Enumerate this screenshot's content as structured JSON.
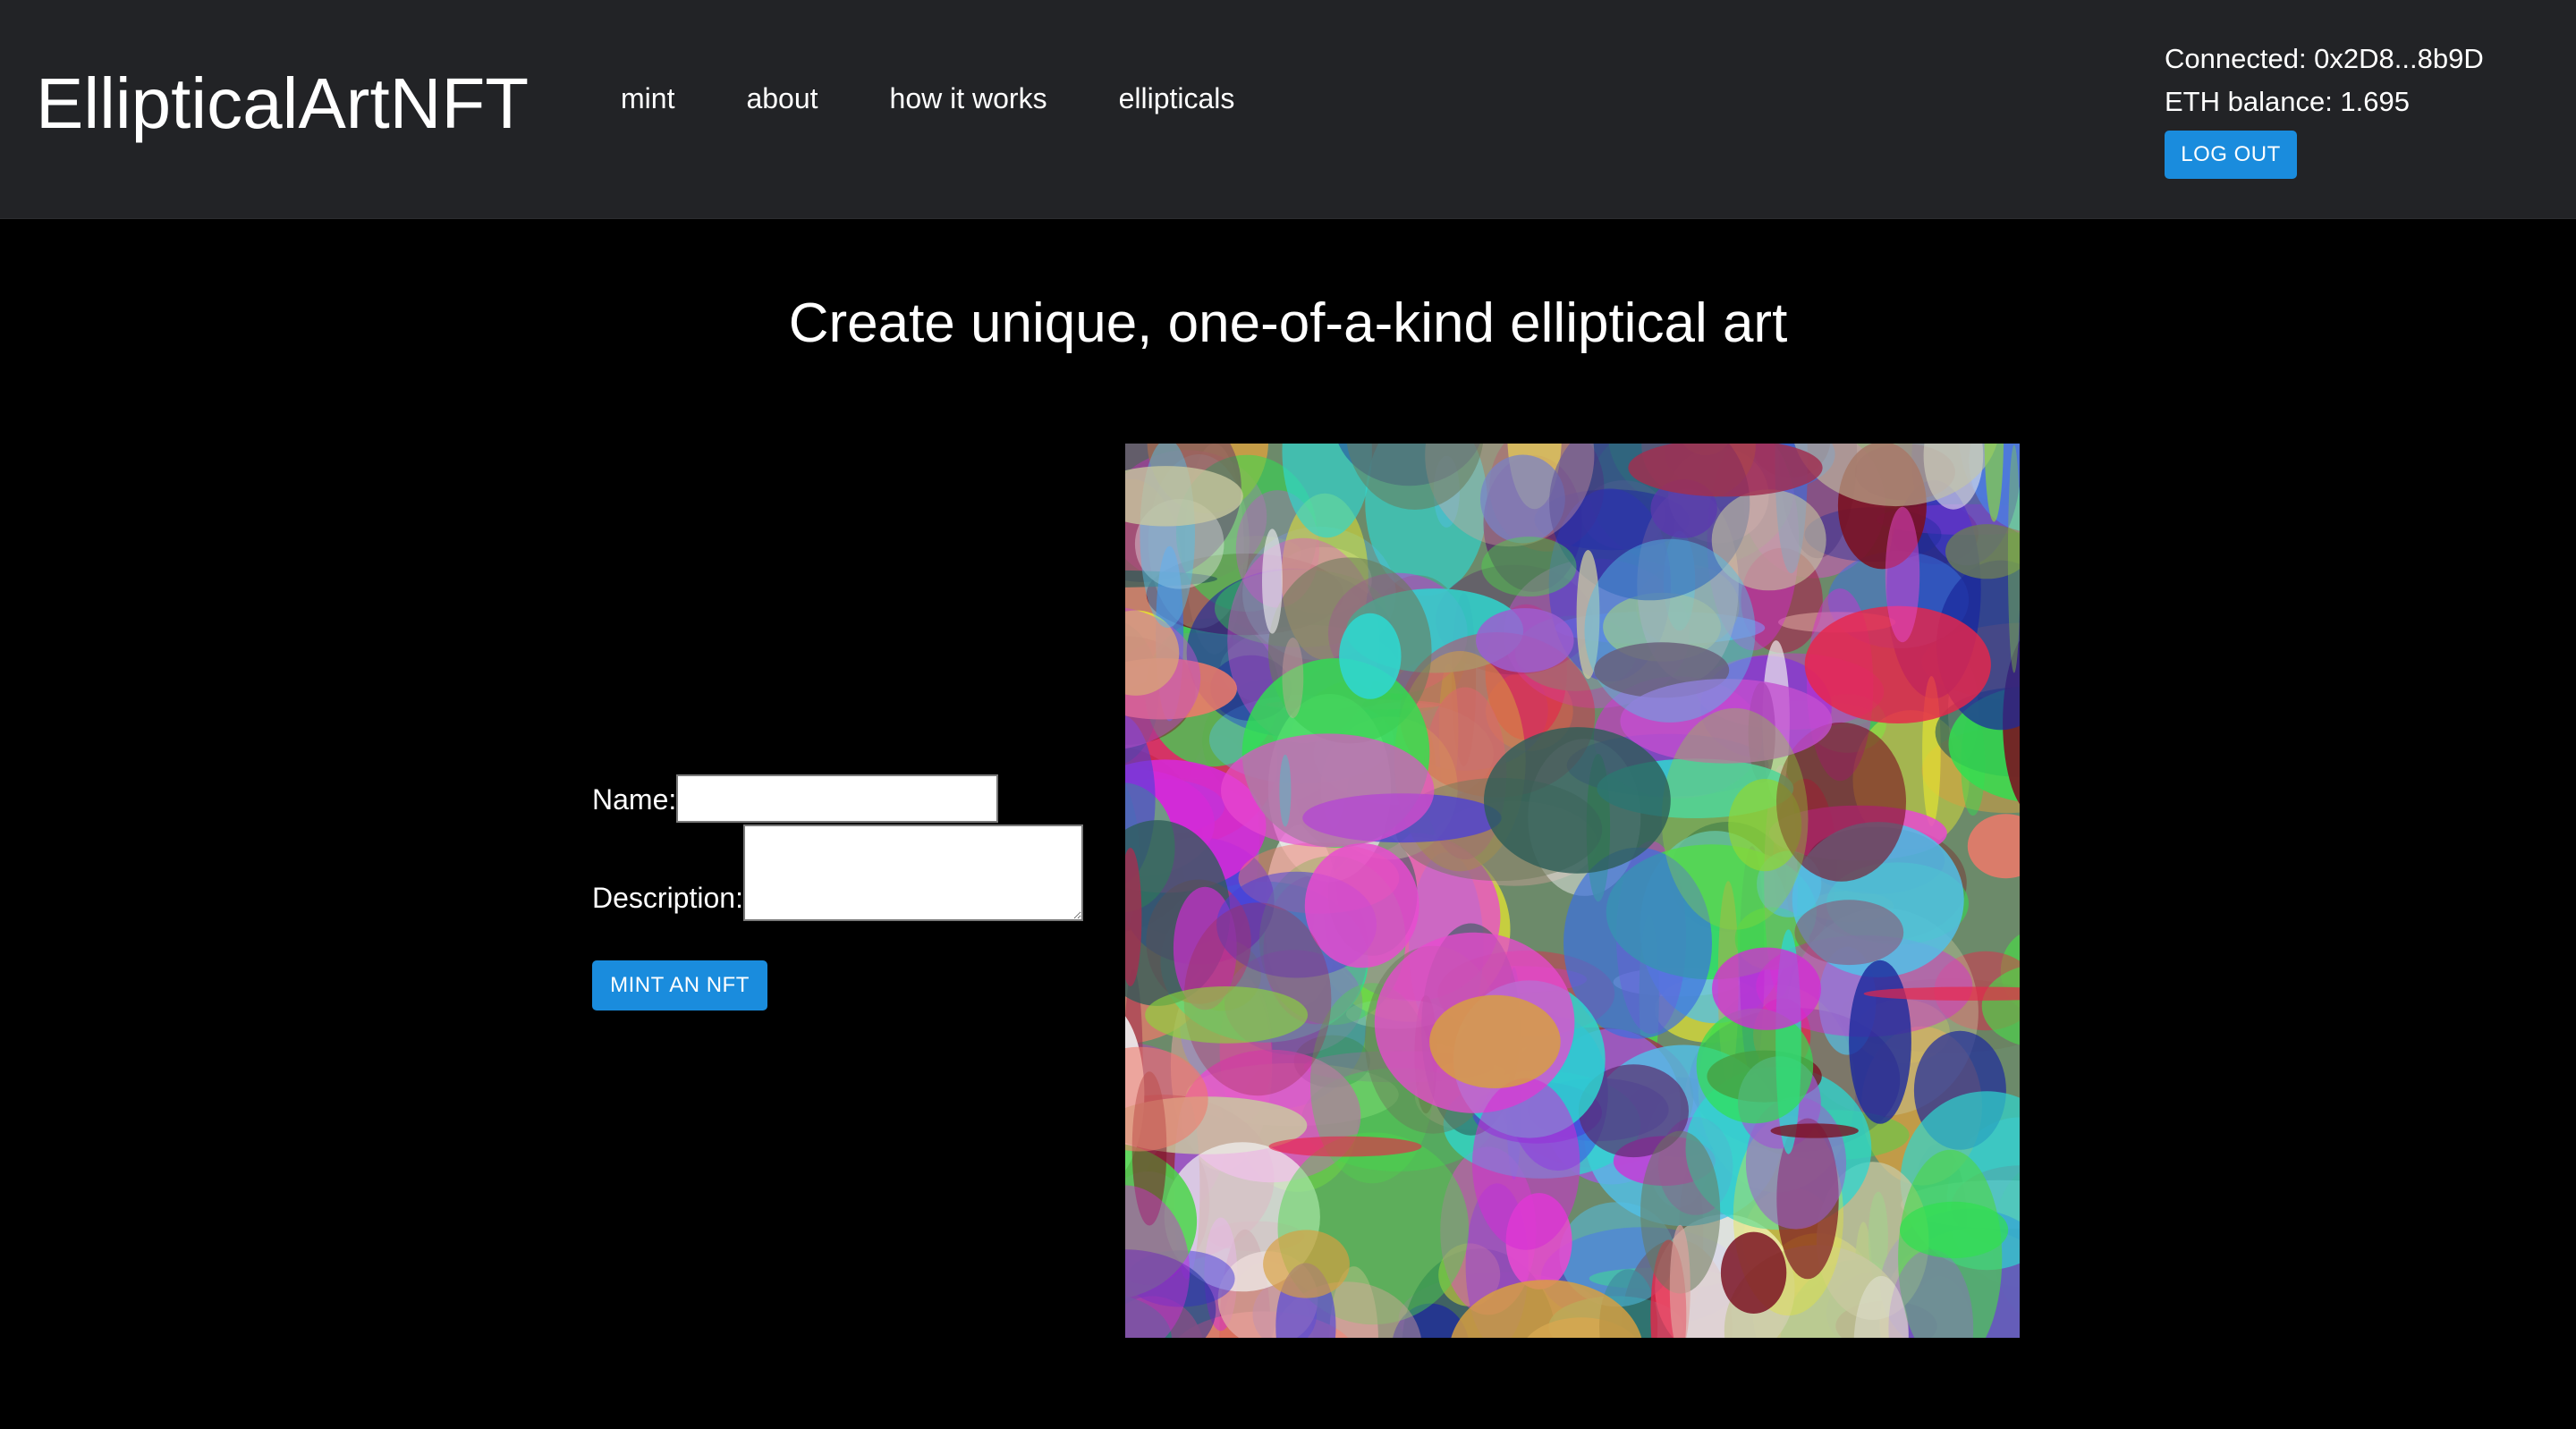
{
  "brand": "EllipticalArtNFT",
  "nav": {
    "links": [
      "mint",
      "about",
      "how it works",
      "ellipticals"
    ]
  },
  "account": {
    "connected": "Connected: 0x2D8...8b9D",
    "balance": "ETH balance: 1.695",
    "logout_label": "LOG OUT"
  },
  "hero": {
    "title": "Create unique, one-of-a-kind elliptical art"
  },
  "form": {
    "name_label": "Name:",
    "name_value": "",
    "description_label": "Description:",
    "description_value": "",
    "mint_label": "MINT AN NFT"
  },
  "colors": {
    "navbar_bg": "#222326",
    "page_bg": "#000000",
    "button_bg": "#1a8cdd",
    "art_base": "#5b8c62"
  },
  "art": {
    "icon": "generated-elliptical-artwork"
  }
}
